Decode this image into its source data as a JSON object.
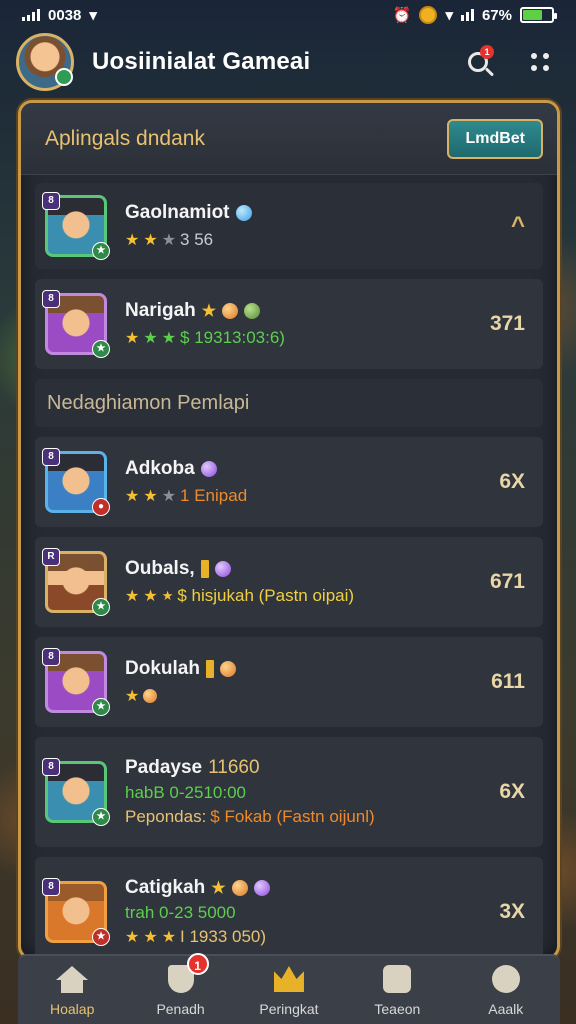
{
  "status_bar": {
    "time": "0038",
    "battery_percent": "67%",
    "battery_level": 0.67,
    "icons": [
      "signal-icon",
      "wifi-icon",
      "alarm-icon",
      "coin-icon",
      "wifi-icon",
      "signal-icon",
      "battery-icon"
    ]
  },
  "header": {
    "title": "Uosiinialat Gameai",
    "notification_count": "1"
  },
  "panel": {
    "title": "Aplingals dndank",
    "action_label": "LmdBet"
  },
  "top_list": [
    {
      "name": "Gaolnamiot",
      "sub": "3 56",
      "stars": 2,
      "sub_color": "grey",
      "right": "^"
    },
    {
      "name": "Narigah",
      "sub": "$ 19313:03:6)",
      "stars": 3,
      "sub_color": "green",
      "right": "371"
    }
  ],
  "section": {
    "title": "Nedaghiamon Pemlapi"
  },
  "players": [
    {
      "name": "Adkoba",
      "sub": "1 Enipad",
      "stars": 2,
      "sub_color": "orange",
      "right": "6X"
    },
    {
      "name": "Oubals,",
      "sub": "$ hisjukah (Pastn oipai)",
      "stars": 2,
      "sub_color": "yellow",
      "right": "671"
    },
    {
      "name": "Dokulah",
      "sub": "",
      "stars": 1,
      "sub_color": "grey",
      "right": "611"
    },
    {
      "name": "Padayse",
      "name_extra": "11660",
      "line2": "habB 0-2510:00",
      "line3_label": "Pepondas:",
      "line3": "$ Fokab (Fastn oijunl)",
      "right": "6X"
    },
    {
      "name": "Catigkah",
      "line2": "trah 0-23 5000",
      "sub": "I 1933 050)",
      "stars": 3,
      "right": "3X"
    }
  ],
  "bottom_nav": [
    {
      "label": "Hoalap",
      "icon": "home-icon",
      "active": true
    },
    {
      "label": "Penadh",
      "icon": "shield-icon",
      "badge": "1"
    },
    {
      "label": "Peringkat",
      "icon": "crown-icon"
    },
    {
      "label": "Teaeon",
      "icon": "team-icon"
    },
    {
      "label": "Aaalk",
      "icon": "profile-icon"
    }
  ]
}
